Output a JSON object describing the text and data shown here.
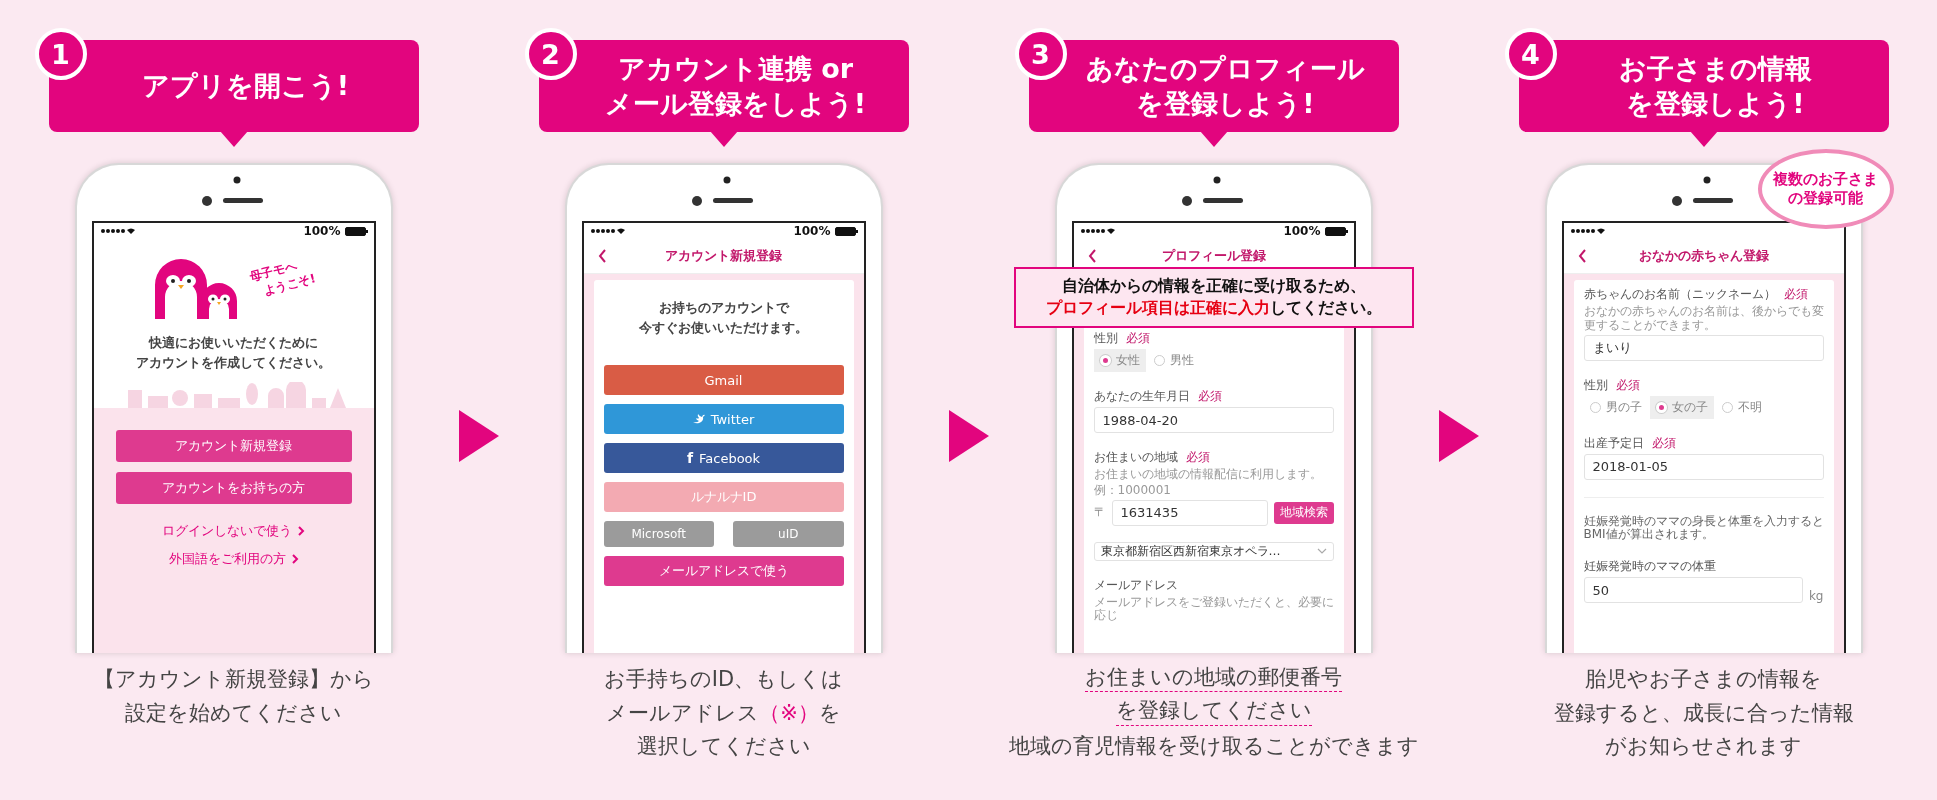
{
  "steps": [
    {
      "number": "1",
      "title": [
        "アプリを開こう!"
      ],
      "screen": {
        "kind": "welcome",
        "status": "100%",
        "greeting": [
          "母子モへ",
          "ようこそ!"
        ],
        "message": [
          "快適にお使いいただくために",
          "アカウントを作成してください。"
        ],
        "buttons": [
          "アカウント新規登録",
          "アカウントをお持ちの方"
        ],
        "links": [
          "ログインしないで使う",
          "外国語をご利用の方"
        ]
      },
      "caption": [
        {
          "underlined": false,
          "parts": [
            {
              "text": "【アカウント新規登録】から",
              "accent": false
            }
          ]
        },
        {
          "underlined": false,
          "parts": [
            {
              "text": "設定を始めてください",
              "accent": false
            }
          ]
        }
      ]
    },
    {
      "number": "2",
      "title": [
        "アカウント連携 or",
        "メール登録をしよう!"
      ],
      "screen": {
        "kind": "accounts",
        "status": "100%",
        "nav_title": "アカウント新規登録",
        "message": [
          "お持ちのアカウントで",
          "今すぐお使いいただけます。"
        ],
        "buttons": [
          {
            "label": "Gmail",
            "kind": "plain",
            "color": "#d95c45"
          },
          {
            "label": "Twitter",
            "kind": "bird",
            "color": "#2f97d8"
          },
          {
            "label": "Facebook",
            "kind": "glyph",
            "glyph": "f",
            "color": "#37589a"
          },
          {
            "label": "ルナルナID",
            "kind": "plain",
            "color": "#f3aab2"
          },
          {
            "label": "Microsoft",
            "kind": "half",
            "color": "#9b9b9b"
          },
          {
            "label": "uID",
            "kind": "half",
            "color": "#9b9b9b"
          },
          {
            "label": "メールアドレスで使う",
            "kind": "plain",
            "color": "#de3a8f"
          }
        ]
      },
      "caption": [
        {
          "underlined": false,
          "parts": [
            {
              "text": "お手持ちのID、もしくは",
              "accent": false
            }
          ]
        },
        {
          "underlined": false,
          "parts": [
            {
              "text": "メールアドレス",
              "accent": false
            },
            {
              "text": "（※）",
              "accent": true
            },
            {
              "text": "を",
              "accent": false
            }
          ]
        },
        {
          "underlined": false,
          "parts": [
            {
              "text": "選択してください",
              "accent": false
            }
          ]
        }
      ]
    },
    {
      "number": "3",
      "title": [
        "あなたのプロフィール",
        "を登録しよう!"
      ],
      "screen": {
        "kind": "form",
        "status": "100%",
        "nav_title": "プロフィール登録",
        "callout": [
          {
            "parts": [
              {
                "text": "自治体からの情報を正確に受け取るため、",
                "accent": false
              }
            ]
          },
          {
            "parts": [
              {
                "text": "プロフィール項目は正確に入力",
                "accent": true
              },
              {
                "text": "してください。",
                "accent": false
              }
            ]
          }
        ],
        "fields": [
          {
            "kind": "radio",
            "label": "性別",
            "required": "必須",
            "options": [
              {
                "label": "女性",
                "selected": true
              },
              {
                "label": "男性",
                "selected": false
              }
            ]
          },
          {
            "kind": "input",
            "label": "あなたの生年月日",
            "required": "必須",
            "value": "1988-04-20"
          },
          {
            "kind": "postal",
            "label": "お住まいの地域",
            "required": "必須",
            "help": [
              "お住まいの地域の情報配信に利用します。",
              "例：1000001"
            ],
            "prefix": "〒",
            "value": "1631435",
            "button": "地域検索"
          },
          {
            "kind": "select",
            "value": "東京都新宿区西新宿東京オペラ…"
          },
          {
            "kind": "label",
            "label": "メールアドレス",
            "help": [
              "メールアドレスをご登録いただくと、必要に応じ"
            ]
          }
        ]
      },
      "caption": [
        {
          "underlined": true,
          "parts": [
            {
              "text": "お住まいの地域の郵便番号",
              "accent": false
            }
          ]
        },
        {
          "underlined": true,
          "parts": [
            {
              "text": "を登録してください",
              "accent": false
            }
          ]
        },
        {
          "underlined": false,
          "parts": [
            {
              "text": "地域の育児情報を受け取ることができます",
              "accent": false
            }
          ]
        }
      ]
    },
    {
      "number": "4",
      "title": [
        "お子さまの情報",
        "を登録しよう!"
      ],
      "screen": {
        "kind": "form",
        "nav_title": "おなかの赤ちゃん登録",
        "bubble": [
          "複数のお子さま",
          "の登録可能"
        ],
        "fields": [
          {
            "kind": "input",
            "label": "赤ちゃんのお名前（ニックネーム）",
            "required": "必須",
            "help": [
              "おなかの赤ちゃんのお名前は、後からでも変更することができます。"
            ],
            "value": "まいり"
          },
          {
            "kind": "radio",
            "label": "性別",
            "required": "必須",
            "options": [
              {
                "label": "男の子",
                "selected": false
              },
              {
                "label": "女の子",
                "selected": true
              },
              {
                "label": "不明",
                "selected": false
              }
            ]
          },
          {
            "kind": "input",
            "label": "出産予定日",
            "required": "必須",
            "value": "2018-01-05"
          },
          {
            "kind": "divider"
          },
          {
            "kind": "note",
            "help": [
              "妊娠発覚時のママの身長と体重を入力するとBMI値が算出されます。"
            ]
          },
          {
            "kind": "input",
            "label": "妊娠発覚時のママの体重",
            "value": "50",
            "unit": "kg"
          }
        ]
      },
      "caption": [
        {
          "underlined": false,
          "parts": [
            {
              "text": "胎児やお子さまの情報を",
              "accent": false
            }
          ]
        },
        {
          "underlined": false,
          "parts": [
            {
              "text": "登録すると、成長に合った情報",
              "accent": false
            }
          ]
        },
        {
          "underlined": false,
          "parts": [
            {
              "text": "がお知らせされます",
              "accent": false
            }
          ]
        }
      ]
    }
  ]
}
